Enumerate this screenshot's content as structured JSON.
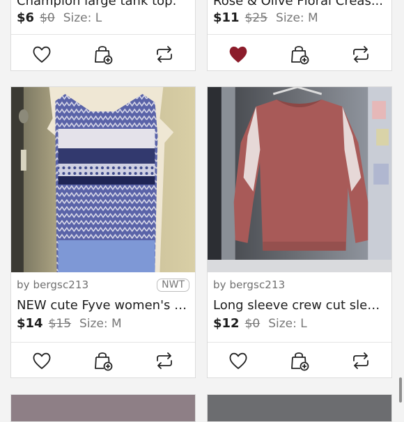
{
  "listings": [
    {
      "title": "Champion large tank top.",
      "price": "$6",
      "original_price": "$0",
      "size": "Size: L",
      "liked": false
    },
    {
      "title": "Rose & Olive Floral Creas...",
      "price": "$11",
      "original_price": "$25",
      "size": "Size: M",
      "liked": true
    },
    {
      "seller": "by bergsc213",
      "badge": "NWT",
      "title": "NEW cute Fyve women's t...",
      "price": "$14",
      "original_price": "$15",
      "size": "Size: M",
      "liked": false
    },
    {
      "seller": "by bergsc213",
      "title": "Long sleeve crew cut slee...",
      "price": "$12",
      "original_price": "$0",
      "size": "Size: L",
      "liked": false
    }
  ],
  "icons": {
    "like": "heart-icon",
    "bundle": "shopping-bag-add-icon",
    "share": "share-repost-icon"
  },
  "colors": {
    "liked_heart": "#8c1c2b",
    "icon_stroke": "#222222"
  }
}
